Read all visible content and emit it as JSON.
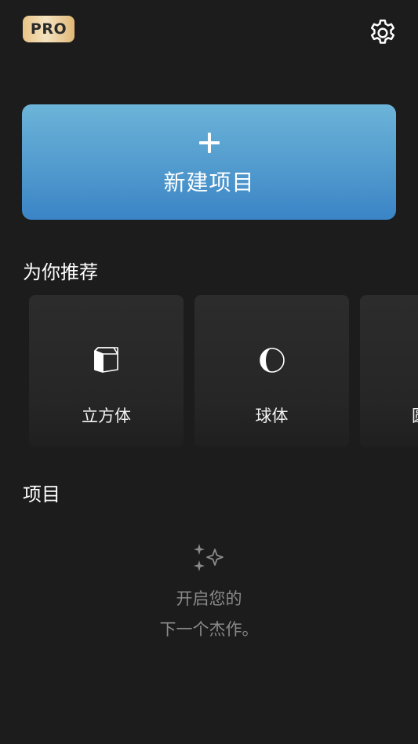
{
  "header": {
    "pro_badge_label": "PRO",
    "settings_icon": "gear-icon"
  },
  "new_project": {
    "icon": "plus-icon",
    "label": "新建项目"
  },
  "recommended": {
    "title": "为你推荐",
    "cards": [
      {
        "label": "立方体",
        "icon": "cube-icon"
      },
      {
        "label": "球体",
        "icon": "sphere-icon"
      },
      {
        "label": "圆",
        "icon": ""
      }
    ]
  },
  "projects": {
    "title": "项目",
    "empty": {
      "icon": "sparkle-icon",
      "line1": "开启您的",
      "line2": "下一个杰作。"
    }
  },
  "colors": {
    "background": "#1c1c1c",
    "card_background": "#2a2a2a",
    "new_project_gradient_top": "#6cb4d8",
    "new_project_gradient_bottom": "#3a84c7",
    "pro_badge_gold": "#e9c485",
    "muted_text": "#8a8a8a"
  }
}
